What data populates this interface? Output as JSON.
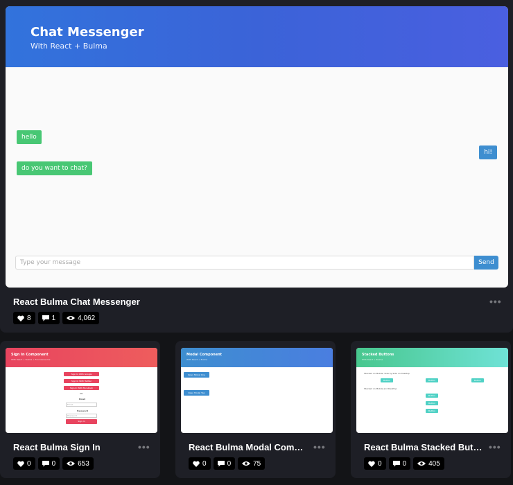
{
  "featured": {
    "preview": {
      "title": "Chat Messenger",
      "subtitle": "With React + Bulma",
      "messages": [
        {
          "text": "hello",
          "side": "left",
          "color": "#48c774"
        },
        {
          "text": "hi!",
          "side": "right",
          "color": "#3e8ed0"
        },
        {
          "text": "do you want to chat?",
          "side": "left",
          "color": "#48c774"
        }
      ],
      "input_placeholder": "Type your message",
      "send_label": "Send"
    },
    "title": "React Bulma Chat Messenger",
    "stats": {
      "likes": "8",
      "comments": "1",
      "views": "4,062"
    }
  },
  "cards": [
    {
      "title": "React Bulma Sign In",
      "stats": {
        "likes": "0",
        "comments": "0",
        "views": "653"
      },
      "thumb": {
        "title": "Sign In Component",
        "subtitle": "With React + Bulma + Font Awesome",
        "buttons": [
          "Sign In With Google",
          "Sign In With Twitter",
          "Sign In With Facebook"
        ],
        "or": "OR",
        "email_label": "Email",
        "email_placeholder": "Email",
        "password_label": "Password",
        "password_placeholder": "Password",
        "submit": "Sign In"
      }
    },
    {
      "title": "React Bulma Modal Compo...",
      "stats": {
        "likes": "0",
        "comments": "0",
        "views": "75"
      },
      "thumb": {
        "title": "Modal Component",
        "subtitle": "With React + Bulma",
        "buttons": [
          "Open Modal One",
          "Open Modal Two"
        ]
      }
    },
    {
      "title": "React Bulma Stacked Butto...",
      "stats": {
        "likes": "0",
        "comments": "0",
        "views": "405"
      },
      "thumb": {
        "title": "Stacked Buttons",
        "subtitle": "With React + Bulma",
        "caption1": "Stacked on Mobile, Side by Side on Desktop",
        "caption2": "Stacked on Mobile and Desktop",
        "row_buttons": [
          "Button",
          "Button",
          "Button"
        ],
        "stack_buttons": [
          "Button",
          "Button",
          "Button"
        ]
      }
    }
  ],
  "colors": {
    "bulma_blue": "#3273dc",
    "bulma_green": "#48c774",
    "bulma_info": "#3e8ed0",
    "signin_red": "#e8445f",
    "teal": "#4fd1c5"
  },
  "icons": {
    "like": "heart-icon",
    "comment": "comment-icon",
    "views": "eye-icon",
    "more": "more-dots-icon"
  }
}
